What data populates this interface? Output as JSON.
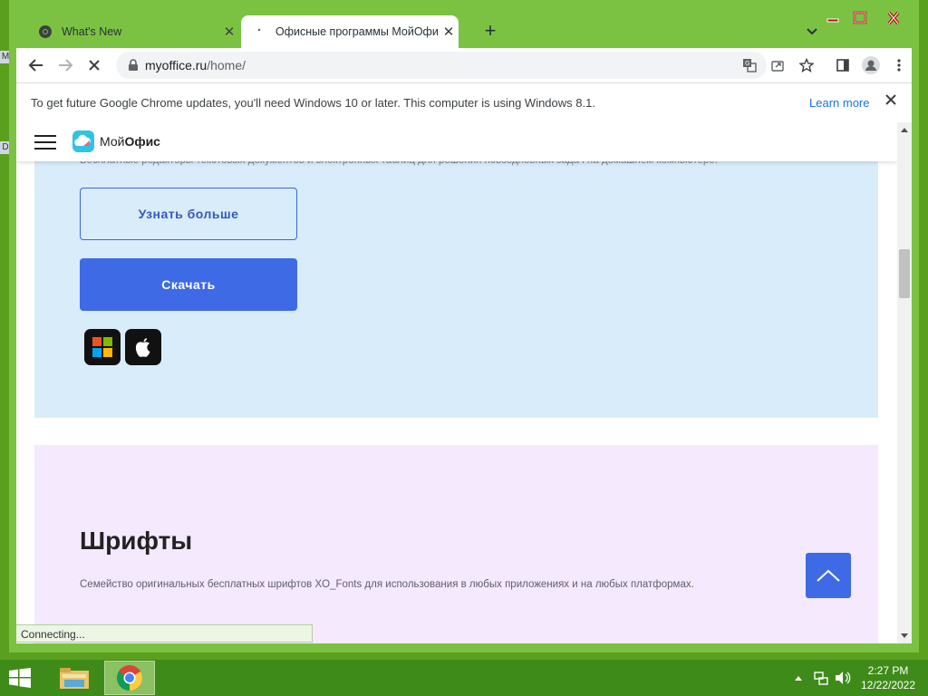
{
  "browser": {
    "tabs": [
      {
        "title": "What's New"
      },
      {
        "title": "Офисные программы МойОфи"
      }
    ],
    "address": {
      "host": "myoffice.ru",
      "path": "/home/"
    },
    "infobar": {
      "message": "To get future Google Chrome updates, you'll need Windows 10 or later. This computer is using Windows 8.1.",
      "link": "Learn more"
    },
    "status": "Connecting..."
  },
  "site": {
    "logo": {
      "part1": "Мой",
      "part2": "Офис"
    },
    "hero": {
      "subtitle": "Бесплатные редакторы текстовых документов и электронных таблиц для  решения повседневных задач на домашнем компьютере.",
      "learn_more": "Узнать больше",
      "download": "Скачать"
    },
    "fonts": {
      "title": "Шрифты",
      "description": "Семейство оригинальных бесплатных шрифтов XO_Fonts для использования в  любых приложениях и на любых платформах."
    }
  },
  "taskbar": {
    "time": "2:27 PM",
    "date": "12/22/2022"
  },
  "colors": {
    "window_frame": "#7cc242",
    "taskbar": "#3f8b19",
    "hero_bg": "#d8ecfa",
    "fonts_bg": "#f5e9fd",
    "accent_blue": "#3e6ae6"
  }
}
